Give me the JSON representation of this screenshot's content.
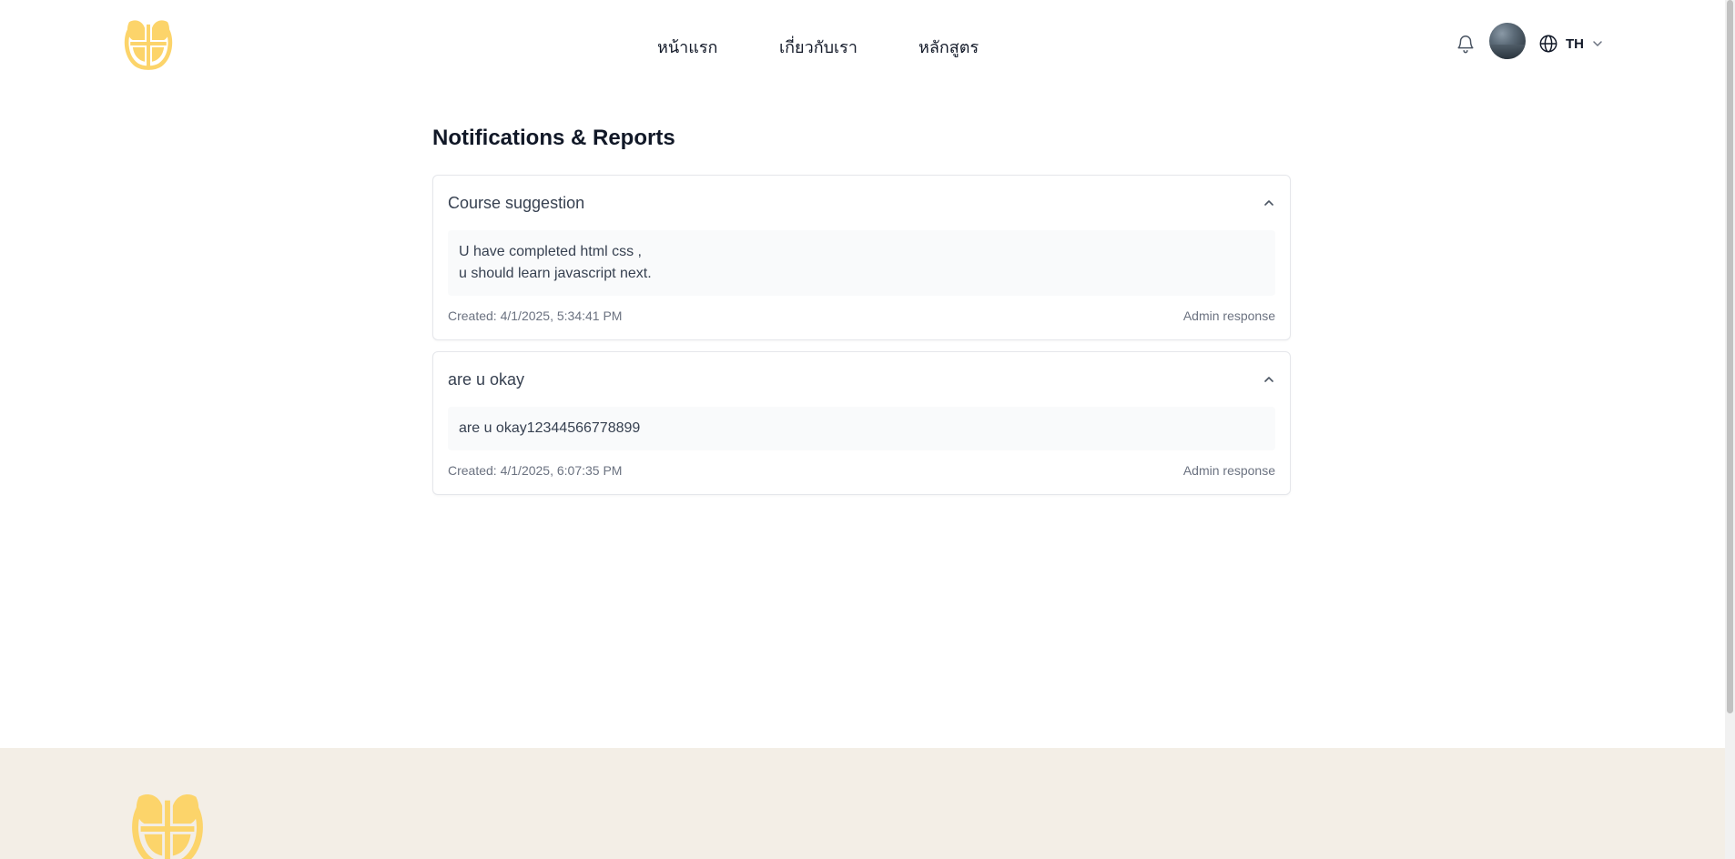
{
  "brand": {
    "logo_icon": "golden-emblem-logo-icon",
    "accent_color": "#FCD46A"
  },
  "nav": {
    "items": [
      {
        "label": "หน้าแรก"
      },
      {
        "label": "เกี่ยวกับเรา"
      },
      {
        "label": "หลักสูตร"
      }
    ]
  },
  "header_actions": {
    "notification_icon": "bell-icon",
    "avatar_icon": "user-avatar",
    "language_icon": "globe-icon",
    "language": "TH",
    "dropdown_icon": "chevron-down-icon"
  },
  "main": {
    "title": "Notifications & Reports",
    "notifications": [
      {
        "title": "Course suggestion",
        "body_lines": [
          "U have completed html css ,",
          "u should learn javascript next."
        ],
        "created": "Created: 4/1/2025, 5:34:41 PM",
        "type": "Admin response",
        "expanded_icon": "chevron-up-icon"
      },
      {
        "title": "are u okay",
        "body_lines": [
          "are u okay12344566778899"
        ],
        "created": "Created: 4/1/2025, 6:07:35 PM",
        "type": "Admin response",
        "expanded_icon": "chevron-up-icon"
      }
    ]
  },
  "footer": {
    "background": "#F3EEE6",
    "logo_icon": "golden-emblem-logo-icon"
  }
}
